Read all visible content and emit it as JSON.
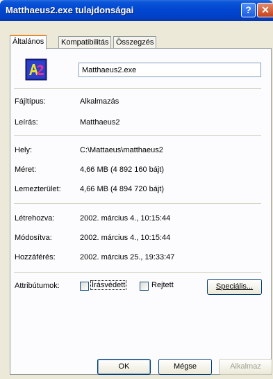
{
  "window": {
    "title": "Matthaeus2.exe tulajdonságai",
    "help_glyph": "?",
    "close_glyph": "✕"
  },
  "tabs": [
    {
      "label": "Általános",
      "active": true
    },
    {
      "label": "Kompatibilitás",
      "active": false
    },
    {
      "label": "Összegzés",
      "active": false
    }
  ],
  "file": {
    "icon": "app-icon",
    "name": "Matthaeus2.exe"
  },
  "properties": {
    "type_label": "Fájltípus:",
    "type_value": "Alkalmazás",
    "desc_label": "Leírás:",
    "desc_value": "Matthaeus2",
    "location_label": "Hely:",
    "location_value": "C:\\Mattaeus\\matthaeus2",
    "size_label": "Méret:",
    "size_value": "4,66 MB (4 892 160 bájt)",
    "disk_label": "Lemezterület:",
    "disk_value": "4,66 MB (4 894 720 bájt)",
    "created_label": "Létrehozva:",
    "created_value": "2002. március 4., 10:15:44",
    "modified_label": "Módosítva:",
    "modified_value": "2002. március 4., 10:15:44",
    "accessed_label": "Hozzáférés:",
    "accessed_value": "2002. március 25., 19:33:47"
  },
  "attributes": {
    "label": "Attribútumok:",
    "readonly_label": "Írásvédett",
    "readonly_checked": false,
    "hidden_label": "Rejtett",
    "hidden_checked": false,
    "special_button": "Speciális..."
  },
  "buttons": {
    "ok": "OK",
    "cancel": "Mégse",
    "apply": "Alkalmaz"
  },
  "colors": {
    "titlebar": "#0041c6",
    "dialog_bg": "#ece9d8",
    "panel_bg": "#fcfcfe",
    "active_tab_accent": "#e68b2c"
  }
}
